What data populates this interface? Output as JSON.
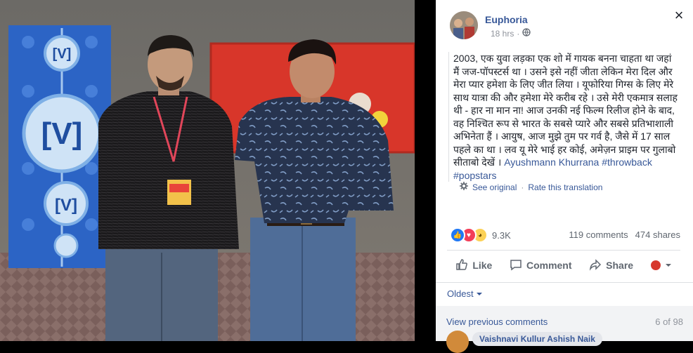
{
  "photo": {
    "board_logo_text": "[V]",
    "description_icon": "photo-of-two-men"
  },
  "post": {
    "page_name": "Euphoria",
    "time": "18 hrs",
    "separator": "·",
    "text_main": "2003, एक युवा लड़का एक शो में गायक बनना चाहता था जहां मैं जज-पॉपस्टर्स था । उसने इसे नहीं जीता लेकिन मेरा दिल और मेरा प्यार हमेशा के लिए जीत लिया । यूफोरिया गिग्स के लिए मेरे साथ यात्रा की और हमेशा मेरे करीब रहे । उसे मेरी एकमात्र सलाह थी - हार ना मान ना! आज उनकी नई फिल्म रिलीज होने के बाद, वह निश्चित रूप से भारत के सबसे प्यारे और सबसे प्रतिभाशाली अभिनेता हैं । आयुष, आज मुझे तुम पर गर्व है, जैसे में 17 साल पहले का था । लव यू मेरे भाई हर कोई, अमेज़न प्राइम पर गुलाबो सीताबो देखें । ",
    "text_links": "Ayushmann Khurrana #throwback #popstars",
    "see_original": "See original",
    "dot": "·",
    "rate_translation": "Rate this translation"
  },
  "stats": {
    "reactions_count": "9.3K",
    "comments": "119 comments",
    "shares": "474 shares"
  },
  "actions": {
    "like": "Like",
    "comment": "Comment",
    "share": "Share"
  },
  "comments": {
    "sort": "Oldest",
    "view_previous": "View previous comments",
    "count": "6 of 98",
    "first_commenter": "Vaishnavi Kullur Ashish Naik"
  },
  "colors": {
    "link": "#385898",
    "like_blue": "#2078f4",
    "love_red": "#f33e58",
    "wow_yellow": "#fcd156"
  }
}
